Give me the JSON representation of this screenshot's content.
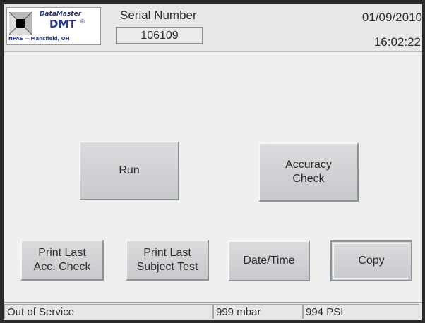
{
  "header": {
    "logo": {
      "brand": "DataMaster",
      "model": "DMT",
      "registered": "®",
      "location": "NPAS -- Mansfield, OH"
    },
    "serial": {
      "label": "Serial Number",
      "value": "106109"
    },
    "date": "01/09/2010",
    "time": "16:02:22"
  },
  "buttons": {
    "run": "Run",
    "accuracy_check": [
      "Accuracy",
      "Check"
    ],
    "print_last_acc_check": [
      "Print Last",
      "Acc. Check"
    ],
    "print_last_subject_test": [
      "Print Last",
      "Subject Test"
    ],
    "date_time": "Date/Time",
    "copy": "Copy"
  },
  "status_bar": {
    "state": "Out of Service",
    "pressure": "999 mbar",
    "psi": "994 PSI"
  },
  "colors": {
    "screen_bg": "#eef0ee",
    "button_face": "#cfd1d4",
    "logo_text": "#2a3a8a"
  }
}
